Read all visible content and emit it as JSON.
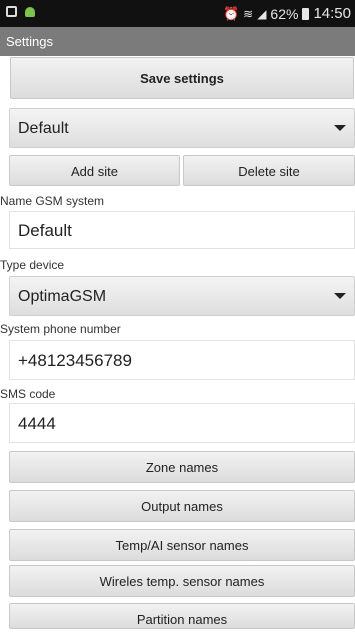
{
  "status_bar": {
    "battery": "62%",
    "time": "14:50",
    "icons": [
      "screenshot-icon",
      "android-icon",
      "alarm-icon",
      "wifi-icon",
      "signal-icon",
      "battery-icon"
    ]
  },
  "app_bar": {
    "title": "Settings"
  },
  "save_button": "Save settings",
  "site": {
    "selected": "Default",
    "add_label": "Add site",
    "delete_label": "Delete site"
  },
  "fields": {
    "name_label": "Name GSM system",
    "name_value": "Default",
    "type_label": "Type device",
    "type_value": "OptimaGSM",
    "phone_label": "System phone number",
    "phone_value": "+48123456789",
    "sms_label": "SMS code",
    "sms_value": "4444"
  },
  "name_buttons": {
    "zone": "Zone names",
    "output": "Output names",
    "temp_ai": "Temp/AI sensor names",
    "wireless": "Wireles temp. sensor names",
    "partition": "Partition names"
  },
  "colors": {
    "status_bar": "#111111",
    "app_bar": "#7b7b7b",
    "background": "#ffffff"
  }
}
